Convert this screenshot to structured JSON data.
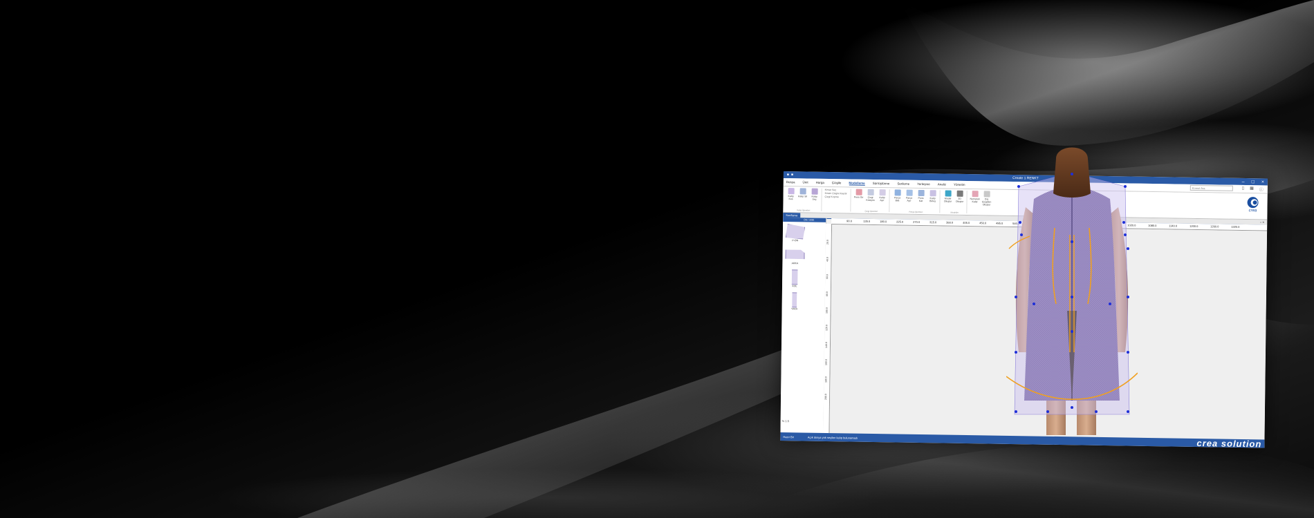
{
  "app": {
    "title": "Create 1 RENKT",
    "tabs_menu": [
      "Dosya",
      "Ünit",
      "Harga",
      "Çizgile",
      "Modelleme",
      "Sürrüştürme",
      "Serileme",
      "Yerleşme",
      "Analiz",
      "Yönetim"
    ],
    "active_tab": "Modelleme",
    "search_placeholder": "Komut Ara",
    "ribbon": {
      "groups": [
        {
          "caption": "Kalıp İşlemleri",
          "buttons": [
            "Kalıp Kes",
            "Kalıp Sil",
            "Kalıp Seç"
          ]
        },
        {
          "caption": "",
          "buttons": [
            "Sürrek Seç",
            "Dikiş Payı Ekle"
          ]
        },
        {
          "caption": "Çizgi İşlemleri",
          "buttons": [
            "Pens Gir",
            "Çizgi Kesişim",
            "Kalıp Ayır"
          ]
        },
        {
          "caption": "Parça İşlemleri",
          "buttons": [
            "Parça Bile",
            "Parça Ayır",
            "Pens Kat",
            "Kalıp Birleş"
          ]
        },
        {
          "caption": "Modeller",
          "buttons": [
            "Model Oluştur",
            "3D Oluştur"
          ]
        },
        {
          "caption": "",
          "buttons": [
            "Numaralı Kalıp",
            "Dış Çizgiden Oluştur"
          ]
        }
      ],
      "extra_options": [
        "Kenar Seç",
        "Kesim Çizgisi Kaydır",
        "Çizgi Kırpma"
      ]
    },
    "doc_tab": "Sınıflama",
    "panel_header": "ÖN / ARK",
    "pieces": [
      {
        "label": "P-ÖN"
      },
      {
        "label": "ARKA"
      },
      {
        "label": "KOL"
      },
      {
        "label": "YAKA"
      }
    ],
    "zoom_label": "% 1.5",
    "ruler_top": [
      "90.0",
      "135.0",
      "180.0",
      "225.0",
      "270.0",
      "315.0",
      "360.0",
      "405.0",
      "450.0",
      "495.0",
      "540.0",
      "585.0",
      "630.0",
      "...",
      "960.0",
      "1020.0",
      "1080.0",
      "1140.0",
      "1200.0",
      "1260.0",
      "1320.0"
    ],
    "ruler_left": [
      "20.0",
      "40.0",
      "60.0",
      "80.0",
      "100.0",
      "120.0",
      "140.0",
      "160.0",
      "180.0",
      "200.0"
    ],
    "status_left": "Hazır  Bir",
    "status_mid": "Açık dosya yok seçilen kalıp bulunamadı",
    "brand": "crea solution",
    "logo_text": "crea"
  },
  "colors": {
    "titlebar": "#2a5aa6",
    "accent": "#1a4ea0",
    "garment": "#b6a9d8",
    "guide_orange": "#f0a020",
    "guide_blue": "#1e2fd8"
  },
  "icons": [
    "minimize-icon",
    "maximize-icon",
    "close-icon",
    "crea-logo-icon"
  ]
}
